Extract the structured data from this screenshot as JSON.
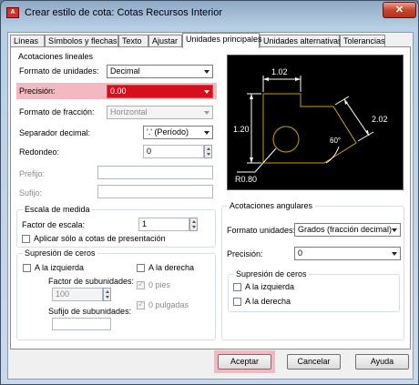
{
  "window": {
    "title": "Crear estilo de cota: Cotas Recursos Interior",
    "close": "✕"
  },
  "tabs": [
    "Líneas",
    "Símbolos y flechas",
    "Texto",
    "Ajustar",
    "Unidades principales",
    "Unidades alternativas",
    "Tolerancias"
  ],
  "active_tab": "Unidades principales",
  "linear": {
    "title": "Acotaciones lineales",
    "unit_format_label": "Formato de unidades:",
    "unit_format_value": "Decimal",
    "precision_label": "Precisión:",
    "precision_value": "0.00",
    "fraction_label": "Formato de fracción:",
    "fraction_value": "Horizontal",
    "separator_label": "Separador decimal:",
    "separator_value": "'.' (Período)",
    "round_label": "Redondeo:",
    "round_value": "0",
    "prefix_label": "Prefijo:",
    "suffix_label": "Sufijo:"
  },
  "scale": {
    "title": "Escala de medida",
    "factor_label": "Factor de escala:",
    "factor_value": "1",
    "layout_only_label": "Aplicar sólo a cotas de presentación"
  },
  "zero_linear": {
    "title": "Supresión de ceros",
    "leading": "A la izquierda",
    "trailing": "A la derecha",
    "subunit_factor_label": "Factor de subunidades:",
    "subunit_factor_value": "100",
    "feet": "0 pies",
    "inches": "0 pulgadas",
    "subunit_suffix_label": "Sufijo de subunidades:"
  },
  "preview": {
    "dim_top": "1.02",
    "dim_left": "1.20",
    "dim_right": "2.02",
    "angle": "60°",
    "radius": "R0.80"
  },
  "angular": {
    "title": "Acotaciones angulares",
    "format_label": "Formato unidades:",
    "format_value": "Grados (fracción decimal)",
    "precision_label": "Precisión:",
    "precision_value": "0"
  },
  "zero_angular": {
    "title": "Supresión de ceros",
    "leading": "A la izquierda",
    "trailing": "A la derecha"
  },
  "buttons": {
    "ok": "Aceptar",
    "cancel": "Cancelar",
    "help": "Ayuda"
  },
  "colors": {
    "highlight": "#f4b8c0",
    "selection": "#d3101c",
    "preview_lines": "#c8a400"
  }
}
